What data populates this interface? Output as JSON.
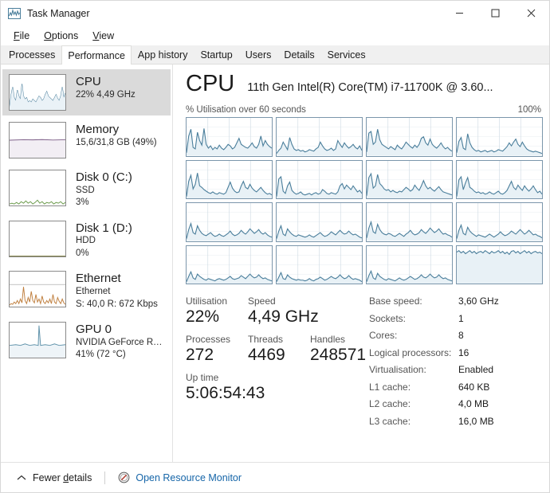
{
  "window": {
    "title": "Task Manager",
    "icon": "task-manager-icon",
    "controls": {
      "minimize": "minimize-icon",
      "maximize": "maximize-icon",
      "close": "close-icon"
    }
  },
  "menu": {
    "items": [
      {
        "label": "File",
        "accel": "F"
      },
      {
        "label": "Options",
        "accel": "O"
      },
      {
        "label": "View",
        "accel": "V"
      }
    ]
  },
  "tabs": {
    "active": "Performance",
    "items": [
      {
        "label": "Processes"
      },
      {
        "label": "Performance"
      },
      {
        "label": "App history"
      },
      {
        "label": "Startup"
      },
      {
        "label": "Users"
      },
      {
        "label": "Details"
      },
      {
        "label": "Services"
      }
    ]
  },
  "sidebar": {
    "items": [
      {
        "name": "cpu",
        "title": "CPU",
        "sub1": "22%  4,49 GHz",
        "sub2": "",
        "selected": true,
        "color": "#4a7e9b",
        "fill": "#eaf2f7"
      },
      {
        "name": "memory",
        "title": "Memory",
        "sub1": "15,6/31,8 GB (49%)",
        "sub2": "",
        "selected": false,
        "color": "#7b5c86",
        "fill": "#f2eef4"
      },
      {
        "name": "disk-0",
        "title": "Disk 0 (C:)",
        "sub1": "SSD",
        "sub2": "3%",
        "selected": false,
        "color": "#6a9a4a",
        "fill": "#f4f8f0"
      },
      {
        "name": "disk-1",
        "title": "Disk 1 (D:)",
        "sub1": "HDD",
        "sub2": "0%",
        "selected": false,
        "color": "#8a8a50",
        "fill": "#ffffff"
      },
      {
        "name": "ethernet",
        "title": "Ethernet",
        "sub1": "Ethernet",
        "sub2": "S: 40,0 R: 672 Kbps",
        "selected": false,
        "color": "#c08040",
        "fill": "#fdf6ee"
      },
      {
        "name": "gpu-0",
        "title": "GPU 0",
        "sub1": "NVIDIA GeForce RTX ...",
        "sub2": "41% (72 °C)",
        "selected": false,
        "color": "#5f92aa",
        "fill": "#eef4f8"
      }
    ]
  },
  "main": {
    "title": "CPU",
    "model": "11th Gen Intel(R) Core(TM) i7-11700K @ 3.60...",
    "graph_caption_left": "% Utilisation over 60 seconds",
    "graph_caption_right": "100%",
    "stats": {
      "utilisation_label": "Utilisation",
      "utilisation_value": "22%",
      "speed_label": "Speed",
      "speed_value": "4,49 GHz",
      "processes_label": "Processes",
      "processes_value": "272",
      "threads_label": "Threads",
      "threads_value": "4469",
      "handles_label": "Handles",
      "handles_value": "248571",
      "uptime_label": "Up time",
      "uptime_value": "5:06:54:43"
    },
    "specs": [
      {
        "key": "Base speed:",
        "value": "3,60 GHz"
      },
      {
        "key": "Sockets:",
        "value": "1"
      },
      {
        "key": "Cores:",
        "value": "8"
      },
      {
        "key": "Logical processors:",
        "value": "16"
      },
      {
        "key": "Virtualisation:",
        "value": "Enabled"
      },
      {
        "key": "L1 cache:",
        "value": "640 KB"
      },
      {
        "key": "L2 cache:",
        "value": "4,0 MB"
      },
      {
        "key": "L3 cache:",
        "value": "16,0 MB"
      }
    ]
  },
  "chart_data": {
    "type": "line",
    "title": "% Utilisation over 60 seconds",
    "ylabel": "% Utilisation",
    "xlabel": "60 seconds",
    "ylim": [
      0,
      100
    ],
    "grid": true,
    "legend": "none",
    "line_color": "#4a7e9b",
    "fill_color": "#e8f1f6",
    "grid_color": "#cfdce4",
    "logical_processors": 16,
    "series": [
      {
        "name": "CPU 0",
        "values": [
          8,
          52,
          70,
          22,
          18,
          62,
          40,
          28,
          72,
          30,
          20,
          26,
          16,
          22,
          18,
          28,
          20,
          16,
          22,
          30,
          26,
          18,
          22,
          34,
          46,
          30,
          26,
          22,
          20,
          26,
          34,
          24,
          20,
          30,
          52,
          26,
          40,
          30,
          24,
          20
        ]
      },
      {
        "name": "CPU 1",
        "values": [
          6,
          14,
          20,
          36,
          26,
          16,
          48,
          30,
          18,
          14,
          16,
          12,
          14,
          10,
          12,
          16,
          14,
          12,
          18,
          22,
          36,
          26,
          18,
          14,
          16,
          20,
          14,
          18,
          40,
          30,
          22,
          34,
          26,
          20,
          24,
          30,
          22,
          18,
          26,
          14
        ]
      },
      {
        "name": "CPU 2",
        "values": [
          10,
          60,
          64,
          30,
          36,
          70,
          42,
          30,
          26,
          22,
          18,
          24,
          20,
          16,
          28,
          22,
          18,
          26,
          36,
          30,
          24,
          20,
          28,
          22,
          30,
          46,
          50,
          34,
          28,
          44,
          30,
          24,
          20,
          26,
          34,
          24,
          18,
          22,
          16,
          12
        ]
      },
      {
        "name": "CPU 3",
        "values": [
          8,
          38,
          48,
          20,
          16,
          58,
          34,
          22,
          16,
          12,
          14,
          10,
          12,
          14,
          10,
          12,
          14,
          10,
          12,
          16,
          14,
          12,
          18,
          24,
          34,
          26,
          36,
          44,
          30,
          24,
          36,
          26,
          18,
          14,
          12,
          10,
          12,
          10,
          8,
          6
        ]
      },
      {
        "name": "CPU 4",
        "values": [
          6,
          46,
          62,
          26,
          38,
          68,
          34,
          30,
          24,
          20,
          16,
          14,
          18,
          14,
          12,
          16,
          14,
          12,
          16,
          30,
          44,
          28,
          20,
          16,
          18,
          34,
          46,
          30,
          26,
          38,
          28,
          22,
          18,
          24,
          30,
          22,
          16,
          12,
          14,
          10
        ]
      },
      {
        "name": "CPU 5",
        "values": [
          6,
          52,
          58,
          20,
          14,
          34,
          44,
          22,
          16,
          12,
          14,
          18,
          12,
          10,
          12,
          14,
          10,
          14,
          16,
          12,
          14,
          24,
          20,
          14,
          12,
          16,
          14,
          12,
          18,
          34,
          40,
          26,
          36,
          30,
          24,
          34,
          26,
          18,
          22,
          14
        ]
      },
      {
        "name": "CPU 6",
        "values": [
          8,
          56,
          66,
          28,
          34,
          64,
          40,
          34,
          26,
          22,
          24,
          18,
          22,
          18,
          16,
          20,
          18,
          24,
          30,
          26,
          20,
          24,
          36,
          28,
          22,
          34,
          48,
          34,
          26,
          30,
          24,
          20,
          26,
          32,
          24,
          18,
          16,
          14,
          12,
          10
        ]
      },
      {
        "name": "CPU 7",
        "values": [
          6,
          50,
          58,
          24,
          42,
          56,
          30,
          26,
          20,
          16,
          18,
          14,
          16,
          12,
          14,
          18,
          14,
          12,
          16,
          20,
          14,
          12,
          16,
          22,
          34,
          46,
          30,
          24,
          36,
          28,
          22,
          34,
          26,
          20,
          26,
          34,
          24,
          16,
          20,
          12
        ]
      },
      {
        "name": "CPU 8",
        "values": [
          6,
          30,
          46,
          22,
          18,
          40,
          28,
          20,
          16,
          14,
          18,
          22,
          16,
          12,
          14,
          18,
          14,
          12,
          16,
          20,
          26,
          18,
          14,
          16,
          20,
          28,
          22,
          18,
          24,
          32,
          26,
          20,
          24,
          30,
          22,
          18,
          22,
          16,
          12,
          10
        ]
      },
      {
        "name": "CPU 9",
        "values": [
          6,
          26,
          40,
          18,
          14,
          32,
          24,
          18,
          14,
          12,
          16,
          14,
          12,
          10,
          12,
          16,
          12,
          10,
          14,
          18,
          22,
          16,
          12,
          14,
          18,
          24,
          20,
          16,
          22,
          28,
          22,
          18,
          20,
          26,
          20,
          16,
          18,
          14,
          10,
          8
        ]
      },
      {
        "name": "CPU 10",
        "values": [
          8,
          34,
          50,
          24,
          20,
          44,
          30,
          22,
          18,
          16,
          20,
          18,
          14,
          12,
          16,
          20,
          16,
          12,
          18,
          22,
          28,
          20,
          16,
          18,
          22,
          30,
          24,
          20,
          26,
          34,
          28,
          22,
          26,
          32,
          24,
          18,
          20,
          16,
          14,
          10
        ]
      },
      {
        "name": "CPU 11",
        "values": [
          6,
          28,
          42,
          20,
          16,
          36,
          26,
          20,
          16,
          12,
          16,
          14,
          12,
          10,
          14,
          18,
          14,
          10,
          14,
          18,
          24,
          18,
          14,
          16,
          20,
          26,
          22,
          18,
          24,
          30,
          24,
          18,
          22,
          28,
          22,
          16,
          18,
          14,
          12,
          8
        ]
      },
      {
        "name": "CPU 12",
        "values": [
          6,
          20,
          32,
          16,
          12,
          26,
          20,
          16,
          12,
          10,
          14,
          12,
          10,
          8,
          12,
          14,
          12,
          10,
          12,
          16,
          20,
          14,
          12,
          14,
          16,
          22,
          18,
          14,
          20,
          26,
          20,
          16,
          18,
          24,
          18,
          14,
          16,
          12,
          10,
          8
        ]
      },
      {
        "name": "CPU 13",
        "values": [
          6,
          18,
          30,
          14,
          12,
          24,
          18,
          14,
          12,
          10,
          12,
          10,
          10,
          8,
          10,
          14,
          10,
          8,
          12,
          14,
          18,
          14,
          10,
          12,
          16,
          20,
          16,
          14,
          18,
          24,
          18,
          14,
          16,
          22,
          16,
          12,
          14,
          12,
          10,
          6
        ]
      },
      {
        "name": "CPU 14",
        "values": [
          6,
          22,
          34,
          16,
          12,
          28,
          20,
          16,
          12,
          10,
          14,
          12,
          10,
          8,
          12,
          16,
          12,
          10,
          12,
          16,
          20,
          16,
          12,
          14,
          18,
          24,
          18,
          16,
          20,
          26,
          20,
          16,
          18,
          24,
          18,
          14,
          16,
          12,
          10,
          8
        ]
      },
      {
        "name": "CPU 15",
        "values": [
          84,
          88,
          82,
          86,
          80,
          84,
          88,
          82,
          86,
          80,
          84,
          86,
          82,
          88,
          84,
          80,
          86,
          82,
          84,
          88,
          82,
          86,
          80,
          84,
          78,
          86,
          88,
          82,
          86,
          80,
          84,
          88,
          82,
          86,
          80,
          84,
          86,
          82,
          84,
          80
        ]
      }
    ]
  },
  "footer": {
    "collapse_label": "Fewer details",
    "collapse_accel": "d",
    "resource_monitor_label": "Open Resource Monitor",
    "resource_monitor_icon": "resource-monitor-icon",
    "chevron_icon": "chevron-up-icon"
  }
}
